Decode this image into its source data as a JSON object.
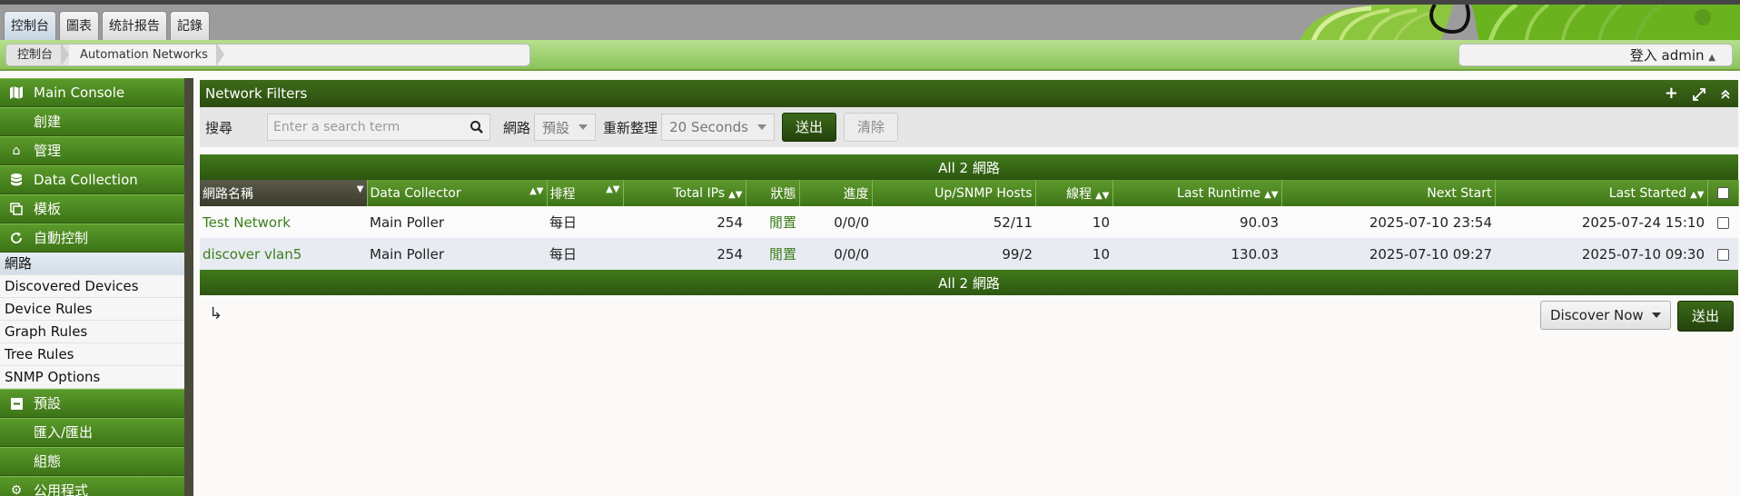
{
  "tabs": [
    "控制台",
    "圖表",
    "统計报告",
    "記錄"
  ],
  "breadcrumb": [
    "控制台",
    "Automation Networks"
  ],
  "login": "登入 admin",
  "sidebar": {
    "sections": [
      {
        "label": "Main Console",
        "icon": "map-icon"
      },
      {
        "label": "創建",
        "icon": ""
      },
      {
        "label": "管理",
        "icon": "home-icon"
      },
      {
        "label": "Data Collection",
        "icon": "database-icon"
      },
      {
        "label": "模板",
        "icon": "clone-icon"
      },
      {
        "label": "自動控制",
        "icon": "refresh-icon"
      }
    ],
    "items": [
      "網路",
      "Discovered Devices",
      "Device Rules",
      "Graph Rules",
      "Tree Rules",
      "SNMP Options"
    ],
    "sections2": [
      {
        "label": "預設",
        "icon": "minus-square-icon"
      },
      {
        "label": "匯入/匯出",
        "icon": ""
      },
      {
        "label": "組態",
        "icon": ""
      },
      {
        "label": "公用程式",
        "icon": "cogs-icon"
      }
    ]
  },
  "panel": {
    "title": "Network Filters"
  },
  "filter": {
    "search_label": "搜尋",
    "search_placeholder": "Enter a search term",
    "network_label": "網路",
    "network_value": "預設",
    "refresh_label": "重新整理",
    "refresh_value": "20 Seconds",
    "go_label": "送出",
    "clear_label": "清除"
  },
  "table": {
    "summary": "All 2 網路",
    "columns": [
      "網路名稱",
      "Data Collector",
      "排程",
      "Total IPs",
      "狀態",
      "進度",
      "Up/SNMP Hosts",
      "線程",
      "Last Runtime",
      "Next Start",
      "Last Started"
    ],
    "rows": [
      [
        "Test Network",
        "Main Poller",
        "每日",
        "254",
        "閒置",
        "0/0/0",
        "52/11",
        "10",
        "90.03",
        "2025-07-10 23:54",
        "2025-07-24 15:10"
      ],
      [
        "discover vlan5",
        "Main Poller",
        "每日",
        "254",
        "閒置",
        "0/0/0",
        "99/2",
        "10",
        "130.03",
        "2025-07-10 09:27",
        "2025-07-10 09:30"
      ]
    ]
  },
  "actions": {
    "select_value": "Discover Now",
    "go_label": "送出"
  },
  "colors": {
    "accent_green": "#3d7417",
    "header_dark_green": "#2a4c0f",
    "link_green": "#3c7d1c"
  }
}
